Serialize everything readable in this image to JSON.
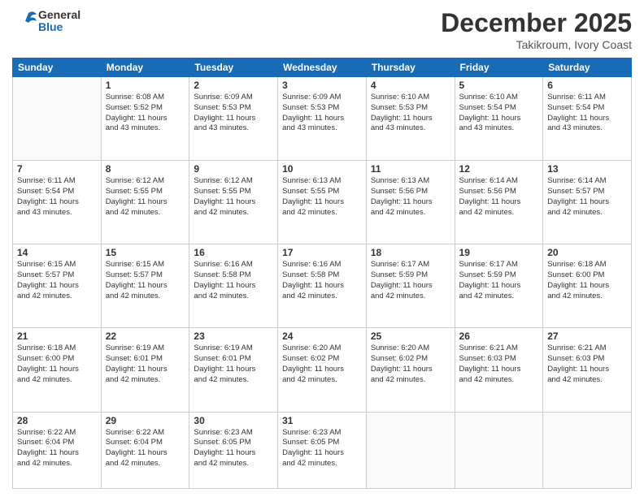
{
  "header": {
    "logo_line1": "General",
    "logo_line2": "Blue",
    "month_title": "December 2025",
    "location": "Takikroum, Ivory Coast"
  },
  "weekdays": [
    "Sunday",
    "Monday",
    "Tuesday",
    "Wednesday",
    "Thursday",
    "Friday",
    "Saturday"
  ],
  "weeks": [
    [
      {
        "day": "",
        "text": ""
      },
      {
        "day": "1",
        "text": "Sunrise: 6:08 AM\nSunset: 5:52 PM\nDaylight: 11 hours\nand 43 minutes."
      },
      {
        "day": "2",
        "text": "Sunrise: 6:09 AM\nSunset: 5:53 PM\nDaylight: 11 hours\nand 43 minutes."
      },
      {
        "day": "3",
        "text": "Sunrise: 6:09 AM\nSunset: 5:53 PM\nDaylight: 11 hours\nand 43 minutes."
      },
      {
        "day": "4",
        "text": "Sunrise: 6:10 AM\nSunset: 5:53 PM\nDaylight: 11 hours\nand 43 minutes."
      },
      {
        "day": "5",
        "text": "Sunrise: 6:10 AM\nSunset: 5:54 PM\nDaylight: 11 hours\nand 43 minutes."
      },
      {
        "day": "6",
        "text": "Sunrise: 6:11 AM\nSunset: 5:54 PM\nDaylight: 11 hours\nand 43 minutes."
      }
    ],
    [
      {
        "day": "7",
        "text": "Sunrise: 6:11 AM\nSunset: 5:54 PM\nDaylight: 11 hours\nand 43 minutes."
      },
      {
        "day": "8",
        "text": "Sunrise: 6:12 AM\nSunset: 5:55 PM\nDaylight: 11 hours\nand 42 minutes."
      },
      {
        "day": "9",
        "text": "Sunrise: 6:12 AM\nSunset: 5:55 PM\nDaylight: 11 hours\nand 42 minutes."
      },
      {
        "day": "10",
        "text": "Sunrise: 6:13 AM\nSunset: 5:55 PM\nDaylight: 11 hours\nand 42 minutes."
      },
      {
        "day": "11",
        "text": "Sunrise: 6:13 AM\nSunset: 5:56 PM\nDaylight: 11 hours\nand 42 minutes."
      },
      {
        "day": "12",
        "text": "Sunrise: 6:14 AM\nSunset: 5:56 PM\nDaylight: 11 hours\nand 42 minutes."
      },
      {
        "day": "13",
        "text": "Sunrise: 6:14 AM\nSunset: 5:57 PM\nDaylight: 11 hours\nand 42 minutes."
      }
    ],
    [
      {
        "day": "14",
        "text": "Sunrise: 6:15 AM\nSunset: 5:57 PM\nDaylight: 11 hours\nand 42 minutes."
      },
      {
        "day": "15",
        "text": "Sunrise: 6:15 AM\nSunset: 5:57 PM\nDaylight: 11 hours\nand 42 minutes."
      },
      {
        "day": "16",
        "text": "Sunrise: 6:16 AM\nSunset: 5:58 PM\nDaylight: 11 hours\nand 42 minutes."
      },
      {
        "day": "17",
        "text": "Sunrise: 6:16 AM\nSunset: 5:58 PM\nDaylight: 11 hours\nand 42 minutes."
      },
      {
        "day": "18",
        "text": "Sunrise: 6:17 AM\nSunset: 5:59 PM\nDaylight: 11 hours\nand 42 minutes."
      },
      {
        "day": "19",
        "text": "Sunrise: 6:17 AM\nSunset: 5:59 PM\nDaylight: 11 hours\nand 42 minutes."
      },
      {
        "day": "20",
        "text": "Sunrise: 6:18 AM\nSunset: 6:00 PM\nDaylight: 11 hours\nand 42 minutes."
      }
    ],
    [
      {
        "day": "21",
        "text": "Sunrise: 6:18 AM\nSunset: 6:00 PM\nDaylight: 11 hours\nand 42 minutes."
      },
      {
        "day": "22",
        "text": "Sunrise: 6:19 AM\nSunset: 6:01 PM\nDaylight: 11 hours\nand 42 minutes."
      },
      {
        "day": "23",
        "text": "Sunrise: 6:19 AM\nSunset: 6:01 PM\nDaylight: 11 hours\nand 42 minutes."
      },
      {
        "day": "24",
        "text": "Sunrise: 6:20 AM\nSunset: 6:02 PM\nDaylight: 11 hours\nand 42 minutes."
      },
      {
        "day": "25",
        "text": "Sunrise: 6:20 AM\nSunset: 6:02 PM\nDaylight: 11 hours\nand 42 minutes."
      },
      {
        "day": "26",
        "text": "Sunrise: 6:21 AM\nSunset: 6:03 PM\nDaylight: 11 hours\nand 42 minutes."
      },
      {
        "day": "27",
        "text": "Sunrise: 6:21 AM\nSunset: 6:03 PM\nDaylight: 11 hours\nand 42 minutes."
      }
    ],
    [
      {
        "day": "28",
        "text": "Sunrise: 6:22 AM\nSunset: 6:04 PM\nDaylight: 11 hours\nand 42 minutes."
      },
      {
        "day": "29",
        "text": "Sunrise: 6:22 AM\nSunset: 6:04 PM\nDaylight: 11 hours\nand 42 minutes."
      },
      {
        "day": "30",
        "text": "Sunrise: 6:23 AM\nSunset: 6:05 PM\nDaylight: 11 hours\nand 42 minutes."
      },
      {
        "day": "31",
        "text": "Sunrise: 6:23 AM\nSunset: 6:05 PM\nDaylight: 11 hours\nand 42 minutes."
      },
      {
        "day": "",
        "text": ""
      },
      {
        "day": "",
        "text": ""
      },
      {
        "day": "",
        "text": ""
      }
    ]
  ]
}
